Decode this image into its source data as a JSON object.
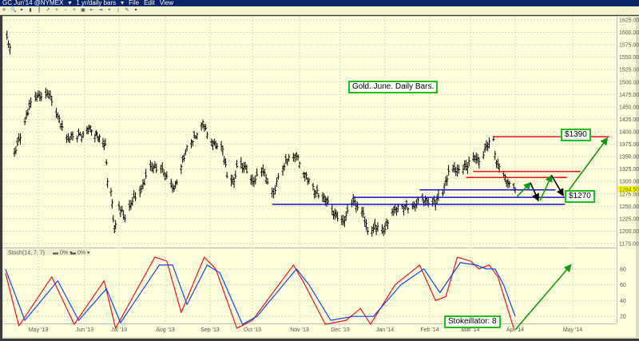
{
  "window": {
    "symbol": "GC Jun'14 @NYMEX",
    "period": "1 yr/daily bars",
    "menu": [
      "File",
      "Edit",
      "View"
    ]
  },
  "toolbar_icons": [
    "crosshair-icon",
    "zoom-icon",
    "dropdown-icon",
    "bar-icon",
    "candle-icon",
    "trend-icon",
    "zoom-in-icon",
    "zoom-out-icon",
    "cross-icon",
    "fit-icon",
    "scroll-left-icon",
    "scroll-right-icon",
    "cursor-icon",
    "marker-icon",
    "draw-icon",
    "dropdown-icon"
  ],
  "colors": {
    "background": "#ffffdd",
    "bars": "#000000",
    "resistance": "#ee1111",
    "support": "#1111dd",
    "arrow_up": "#119911",
    "arrow_down": "#000000",
    "stoch_k": "#ee1122",
    "stoch_d": "#1144ee",
    "last_price_bg": "#ffff00",
    "note_border": "#1fbf1f"
  },
  "chart_data": [
    {
      "type": "bar",
      "title": "Gold. June. Daily Bars.",
      "ylim": [
        1175,
        1625
      ],
      "yticks": [
        1625,
        1600,
        1575,
        1550,
        1525,
        1500,
        1475,
        1450,
        1425,
        1400,
        1375,
        1350,
        1325,
        1300,
        1275,
        1250,
        1225,
        1200,
        1175
      ],
      "ytick_format": "0.00",
      "last_price": "1284.50",
      "xticks": [
        "May '13",
        "Jun '13",
        "Jul '13",
        "Aug '13",
        "Sep '13",
        "Oct '13",
        "Nov '13",
        "Dec '13",
        "Jan '14",
        "Feb '14",
        "Mar '14",
        "Apr '14",
        "May '14"
      ],
      "grid": true,
      "closes": [
        [
          "2013-04-10",
          1590
        ],
        [
          "2013-04-12",
          1570
        ],
        [
          "2013-04-15",
          1360
        ],
        [
          "2013-04-17",
          1375
        ],
        [
          "2013-04-22",
          1420
        ],
        [
          "2013-04-26",
          1460
        ],
        [
          "2013-04-30",
          1470
        ],
        [
          "2013-05-03",
          1470
        ],
        [
          "2013-05-08",
          1475
        ],
        [
          "2013-05-14",
          1430
        ],
        [
          "2013-05-20",
          1385
        ],
        [
          "2013-05-24",
          1390
        ],
        [
          "2013-05-31",
          1395
        ],
        [
          "2013-06-06",
          1410
        ],
        [
          "2013-06-12",
          1390
        ],
        [
          "2013-06-19",
          1375
        ],
        [
          "2013-06-21",
          1300
        ],
        [
          "2013-06-24",
          1280
        ],
        [
          "2013-06-27",
          1200
        ],
        [
          "2013-07-01",
          1250
        ],
        [
          "2013-07-05",
          1225
        ],
        [
          "2013-07-10",
          1260
        ],
        [
          "2013-07-16",
          1285
        ],
        [
          "2013-07-22",
          1330
        ],
        [
          "2013-07-29",
          1325
        ],
        [
          "2013-08-02",
          1310
        ],
        [
          "2013-08-07",
          1285
        ],
        [
          "2013-08-12",
          1330
        ],
        [
          "2013-08-16",
          1370
        ],
        [
          "2013-08-23",
          1395
        ],
        [
          "2013-08-27",
          1420
        ],
        [
          "2013-08-30",
          1395
        ],
        [
          "2013-09-05",
          1370
        ],
        [
          "2013-09-10",
          1365
        ],
        [
          "2013-09-13",
          1310
        ],
        [
          "2013-09-18",
          1300
        ],
        [
          "2013-09-20",
          1330
        ],
        [
          "2013-09-26",
          1330
        ],
        [
          "2013-10-01",
          1300
        ],
        [
          "2013-10-08",
          1320
        ],
        [
          "2013-10-15",
          1275
        ],
        [
          "2013-10-18",
          1310
        ],
        [
          "2013-10-25",
          1350
        ],
        [
          "2013-10-30",
          1350
        ],
        [
          "2013-11-05",
          1315
        ],
        [
          "2013-11-12",
          1280
        ],
        [
          "2013-11-19",
          1270
        ],
        [
          "2013-11-25",
          1240
        ],
        [
          "2013-12-03",
          1220
        ],
        [
          "2013-12-10",
          1260
        ],
        [
          "2013-12-17",
          1235
        ],
        [
          "2013-12-20",
          1200
        ],
        [
          "2013-12-27",
          1210
        ],
        [
          "2013-12-31",
          1200
        ],
        [
          "2014-01-06",
          1240
        ],
        [
          "2014-01-13",
          1250
        ],
        [
          "2014-01-20",
          1250
        ],
        [
          "2014-01-27",
          1265
        ],
        [
          "2014-02-03",
          1255
        ],
        [
          "2014-02-10",
          1275
        ],
        [
          "2014-02-14",
          1320
        ],
        [
          "2014-02-20",
          1325
        ],
        [
          "2014-02-26",
          1330
        ],
        [
          "2014-03-03",
          1350
        ],
        [
          "2014-03-07",
          1340
        ],
        [
          "2014-03-12",
          1370
        ],
        [
          "2014-03-17",
          1385
        ],
        [
          "2014-03-19",
          1335
        ],
        [
          "2014-03-21",
          1330
        ],
        [
          "2014-03-25",
          1310
        ],
        [
          "2014-03-27",
          1295
        ],
        [
          "2014-04-01",
          1284.5
        ]
      ],
      "resistance_lines": [
        {
          "level": 1390,
          "from": "2014-03-17",
          "to": "2014-05-20"
        },
        {
          "level": 1320,
          "from": "2014-03-03",
          "to": "2014-05-05"
        },
        {
          "level": 1308,
          "from": "2014-02-26",
          "to": "2014-04-28"
        }
      ],
      "support_lines": [
        {
          "level": 1283,
          "from": "2014-01-25",
          "to": "2014-04-22"
        },
        {
          "level": 1268,
          "from": "2013-12-10",
          "to": "2014-05-04"
        },
        {
          "level": 1254,
          "from": "2013-10-14",
          "to": "2014-04-27"
        }
      ],
      "projection_arrows": [
        {
          "from": [
            "2014-04-02",
            1270
          ],
          "to": [
            "2014-04-09",
            1297
          ],
          "color": "up"
        },
        {
          "from": [
            "2014-04-09",
            1297
          ],
          "to": [
            "2014-04-13",
            1262
          ],
          "color": "down"
        },
        {
          "from": [
            "2014-04-14",
            1262
          ],
          "to": [
            "2014-04-20",
            1312
          ],
          "color": "up"
        },
        {
          "from": [
            "2014-04-20",
            1312
          ],
          "to": [
            "2014-04-26",
            1272
          ],
          "color": "down"
        },
        {
          "from": [
            "2014-04-27",
            1272
          ],
          "to": [
            "2014-05-19",
            1387
          ],
          "color": "up"
        }
      ],
      "annotations": {
        "title_box": "Gold. June. Daily Bars.",
        "target_high": "$1390",
        "target_low": "$1270"
      }
    },
    {
      "type": "line",
      "legend": {
        "name": "Stoch",
        "params": "(14, 7, 7)",
        "series_k": "0%",
        "series_d": "0%"
      },
      "ylim": [
        0,
        100
      ],
      "yticks": [
        80,
        60,
        40,
        20
      ],
      "series": [
        {
          "key": "k",
          "points": [
            [
              "2013-04-09",
              75
            ],
            [
              "2013-04-18",
              8
            ],
            [
              "2013-05-10",
              70
            ],
            [
              "2013-05-25",
              10
            ],
            [
              "2013-06-18",
              65
            ],
            [
              "2013-06-28",
              5
            ],
            [
              "2013-07-25",
              95
            ],
            [
              "2013-08-02",
              90
            ],
            [
              "2013-08-12",
              25
            ],
            [
              "2013-08-28",
              95
            ],
            [
              "2013-09-05",
              80
            ],
            [
              "2013-09-20",
              5
            ],
            [
              "2013-10-01",
              15
            ],
            [
              "2013-10-28",
              85
            ],
            [
              "2013-11-05",
              60
            ],
            [
              "2013-11-20",
              10
            ],
            [
              "2013-12-05",
              15
            ],
            [
              "2013-12-15",
              30
            ],
            [
              "2013-12-22",
              10
            ],
            [
              "2014-01-08",
              60
            ],
            [
              "2014-01-25",
              85
            ],
            [
              "2014-02-05",
              40
            ],
            [
              "2014-02-12",
              45
            ],
            [
              "2014-02-20",
              95
            ],
            [
              "2014-03-01",
              90
            ],
            [
              "2014-03-07",
              80
            ],
            [
              "2014-03-14",
              85
            ],
            [
              "2014-03-20",
              70
            ],
            [
              "2014-03-31",
              5
            ]
          ]
        },
        {
          "key": "d",
          "points": [
            [
              "2013-04-09",
              80
            ],
            [
              "2013-04-22",
              15
            ],
            [
              "2013-05-14",
              65
            ],
            [
              "2013-05-28",
              15
            ],
            [
              "2013-06-20",
              55
            ],
            [
              "2013-07-02",
              12
            ],
            [
              "2013-07-28",
              85
            ],
            [
              "2013-08-06",
              85
            ],
            [
              "2013-08-16",
              35
            ],
            [
              "2013-08-30",
              85
            ],
            [
              "2013-09-08",
              75
            ],
            [
              "2013-09-24",
              10
            ],
            [
              "2013-10-04",
              20
            ],
            [
              "2013-10-30",
              80
            ],
            [
              "2013-11-08",
              60
            ],
            [
              "2013-11-24",
              15
            ],
            [
              "2013-12-10",
              20
            ],
            [
              "2013-12-24",
              20
            ],
            [
              "2014-01-12",
              60
            ],
            [
              "2014-01-28",
              80
            ],
            [
              "2014-02-08",
              50
            ],
            [
              "2014-02-22",
              88
            ],
            [
              "2014-03-05",
              85
            ],
            [
              "2014-03-12",
              80
            ],
            [
              "2014-03-18",
              80
            ],
            [
              "2014-03-24",
              60
            ],
            [
              "2014-04-01",
              20
            ]
          ]
        }
      ],
      "projection_arrow": {
        "from": [
          "2014-04-01",
          3
        ],
        "to": [
          "2014-04-30",
          85
        ]
      },
      "annotation": "Stokeillator: 8"
    }
  ]
}
